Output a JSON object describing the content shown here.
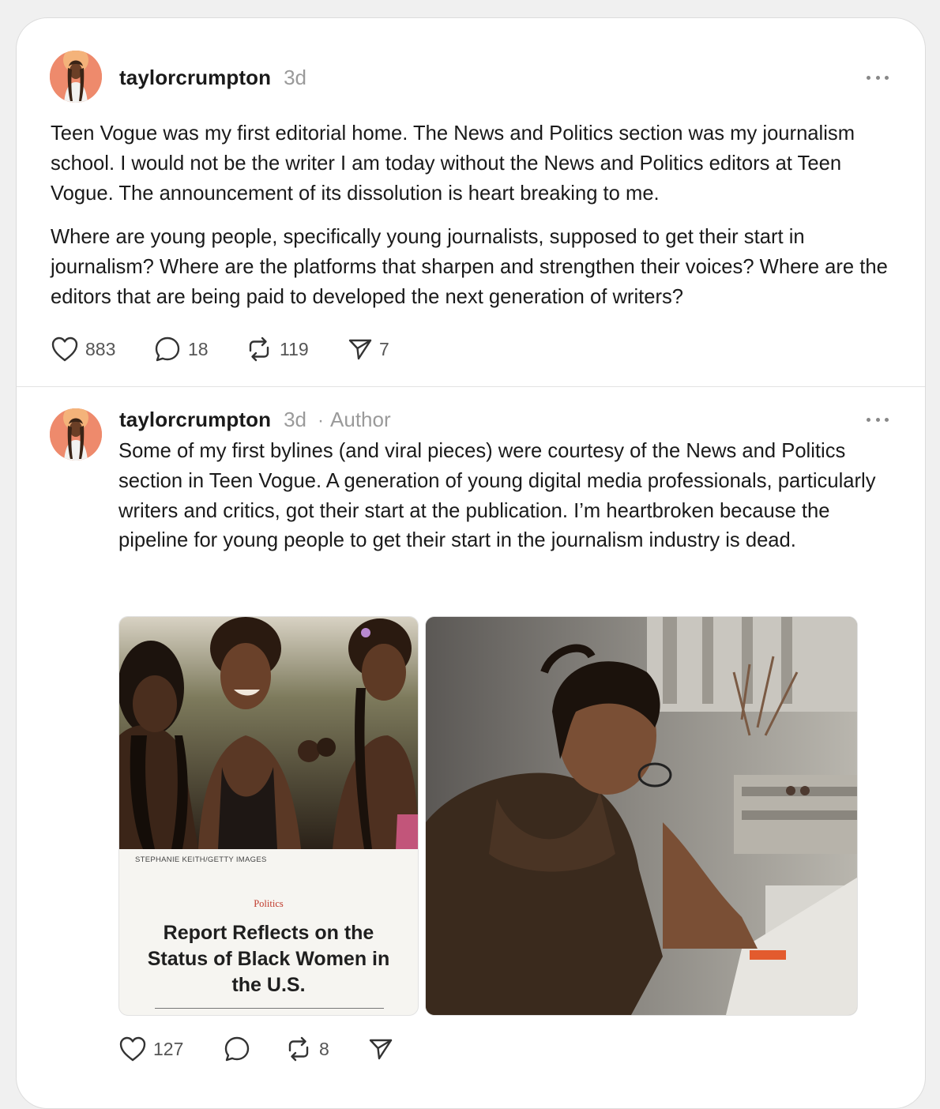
{
  "posts": [
    {
      "username": "taylorcrumpton",
      "time": "3d",
      "paragraphs": [
        "Teen Vogue was my first editorial home. The News and Politics section was my journalism school. I would not be the writer I am today without the News and Politics editors at Teen Vogue. The announcement of its dissolution is heart breaking to me.",
        "Where are young people, specifically young journalists, supposed to get their start in journalism? Where are the platforms that sharpen and strengthen their voices? Where are the editors that are being paid to developed the next generation of writers?"
      ],
      "actions": {
        "likes": "883",
        "comments": "18",
        "restacks": "119",
        "shares": "7"
      }
    },
    {
      "username": "taylorcrumpton",
      "time": "3d",
      "separator": "·",
      "author_tag": "Author",
      "paragraphs": [
        "Some of my first bylines (and viral pieces) were courtesy of the News and Politics section in Teen Vogue. A generation of young digital media professionals, particularly writers and critics, got their start at the publication. I’m heartbroken because the pipeline for young people to get their start in the journalism industry is dead."
      ],
      "article_card": {
        "photo_credit": "STEPHANIE KEITH/GETTY IMAGES",
        "section": "Politics",
        "title": "Report Reflects on the Status of Black Women in the U.S."
      },
      "actions": {
        "likes": "127",
        "restacks": "8"
      }
    }
  ],
  "icons": {
    "like": "heart-icon",
    "comment": "speech-bubble-icon",
    "restack": "restack-arrows-icon",
    "share": "paper-plane-icon",
    "more": "ellipsis-icon"
  },
  "colors": {
    "text": "#1a1a1a",
    "muted": "#9a9a9a",
    "section_label": "#c0392b",
    "card_background": "#ffffff",
    "page_background": "#f0f0f0"
  }
}
